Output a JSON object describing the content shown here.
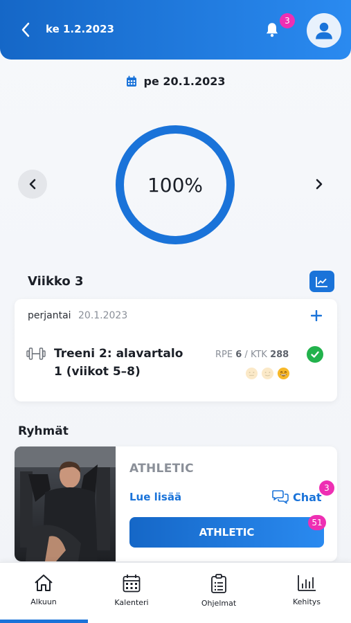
{
  "header": {
    "date": "ke 1.2.2023",
    "notification_count": "3"
  },
  "selected_date": "pe 20.1.2023",
  "progress": {
    "label": "100%",
    "value": 1.0
  },
  "week": {
    "title": "Viikko 3"
  },
  "day_card": {
    "day_name": "perjantai",
    "date": "20.1.2023",
    "workout": {
      "title": "Treeni 2: alavartalo 1 (viikot 5–8)",
      "rpe_label": "RPE",
      "rpe_value": "6",
      "ktk_label": "KTK",
      "ktk_value": "288",
      "completed": true
    }
  },
  "groups": {
    "title": "Ryhmät",
    "items": [
      {
        "name": "ATHLETIC",
        "read_more": "Lue lisää",
        "chat_label": "Chat",
        "chat_badge": "3",
        "button_label": "ATHLETIC",
        "button_badge": "51"
      }
    ]
  },
  "bottom_nav": {
    "items": [
      {
        "label": "Alkuun",
        "icon": "home-icon",
        "active": true
      },
      {
        "label": "Kalenteri",
        "icon": "calendar-icon",
        "active": false
      },
      {
        "label": "Ohjelmat",
        "icon": "clipboard-icon",
        "active": false
      },
      {
        "label": "Kehitys",
        "icon": "bar-chart-icon",
        "active": false
      }
    ]
  },
  "colors": {
    "primary": "#1a73d9",
    "badge": "#ee2fb3",
    "success": "#22b24c"
  }
}
